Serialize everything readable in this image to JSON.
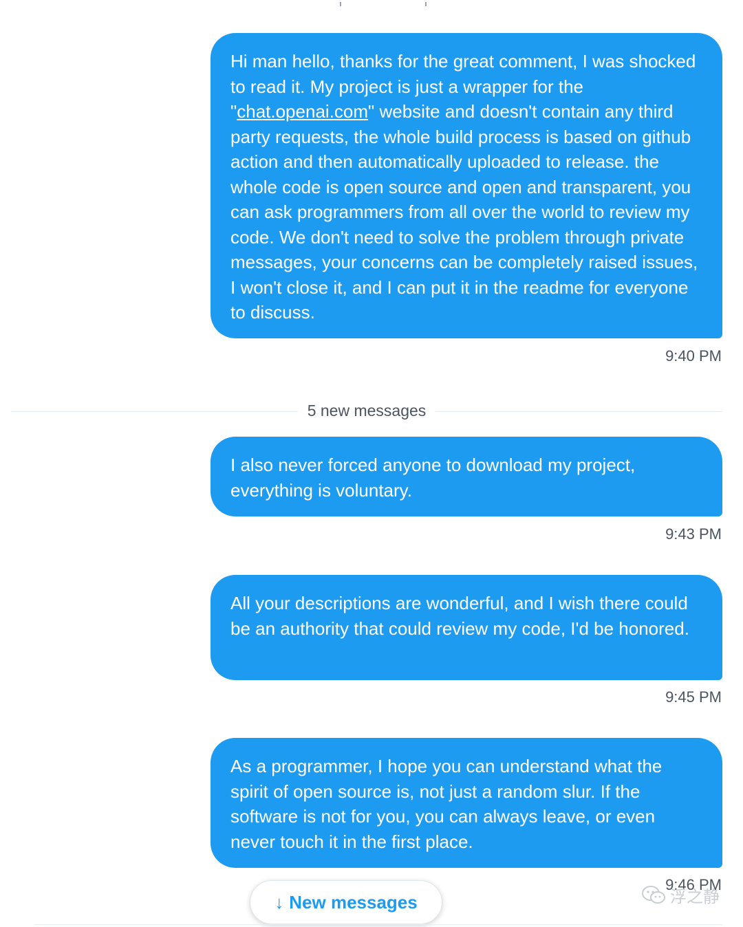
{
  "messages": [
    {
      "text_before": "Hi man hello, thanks for the great comment, I was shocked to read it. My project is just a wrapper for the \"",
      "link": "chat.openai.com",
      "text_after": "\" website and doesn't contain any third party requests, the whole build process is based on github action and then automatically uploaded to release. the whole code is open source and open and transparent, you can ask programmers from all over the world to review my code. We don't need to solve the problem through private messages, your concerns can be completely raised issues, I won't close it, and I can put it in the readme for everyone to discuss.",
      "time": "9:40 PM"
    },
    {
      "text": "I also never forced anyone to download my project, everything is voluntary.",
      "time": "9:43 PM"
    },
    {
      "text": "All your descriptions are wonderful, and I wish there could be an authority that could review my code, I'd be honored.",
      "time": "9:45 PM"
    },
    {
      "text": "As a programmer, I hope you can understand what the spirit of open source is, not just a random slur. If the software is not for you, you can always leave, or even never touch it in the first place.",
      "time": "9:46 PM"
    }
  ],
  "divider": {
    "label": "5 new messages"
  },
  "new_messages_button": {
    "label": "New messages",
    "icon": "arrow-down-icon"
  },
  "watermark": {
    "text": "浮之静",
    "icon": "wechat-icon"
  },
  "colors": {
    "bubble": "#1d9bf0",
    "accent": "#1d9bf0",
    "muted_text": "#4b5560"
  }
}
